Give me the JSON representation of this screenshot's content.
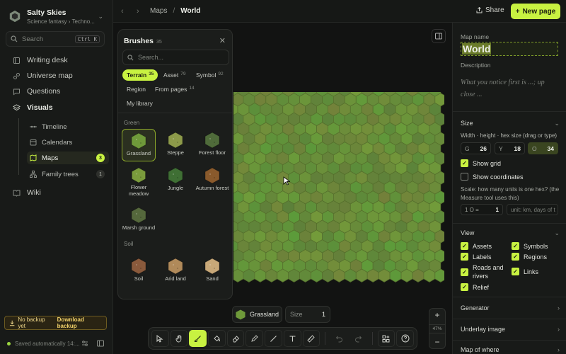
{
  "workspace": {
    "name": "Salty Skies",
    "subtitle": "Science fantasy › Techno..."
  },
  "search": {
    "placeholder": "Search",
    "shortcut": "Ctrl K"
  },
  "nav": {
    "writing_desk": "Writing desk",
    "universe_map": "Universe map",
    "questions": "Questions",
    "visuals": "Visuals",
    "timeline": "Timeline",
    "calendars": "Calendars",
    "maps": "Maps",
    "maps_count": "3",
    "family_trees": "Family trees",
    "family_trees_count": "1",
    "wiki": "Wiki"
  },
  "backup": {
    "status": "No backup yet",
    "action": "Download backup"
  },
  "saved": "Saved automatically 14:...",
  "breadcrumb": {
    "parent": "Maps",
    "separator": "/",
    "current": "World"
  },
  "topbar": {
    "share": "Share",
    "new_page": "New page"
  },
  "brushes": {
    "title": "Brushes",
    "count": "35",
    "search_placeholder": "Search...",
    "tabs": [
      {
        "label": "Terrain",
        "count": "35"
      },
      {
        "label": "Asset",
        "count": "79"
      },
      {
        "label": "Symbol",
        "count": "92"
      },
      {
        "label": "Region",
        "count": ""
      },
      {
        "label": "From pages",
        "count": "14"
      },
      {
        "label": "My library",
        "count": ""
      }
    ],
    "section_green": "Green",
    "green": [
      {
        "label": "Grassland",
        "color": "#6f9a3a"
      },
      {
        "label": "Steppe",
        "color": "#8d9a4a"
      },
      {
        "label": "Forest floor",
        "color": "#4f6b3a"
      },
      {
        "label": "Flower meadow",
        "color": "#7a9b3c"
      },
      {
        "label": "Jungle",
        "color": "#3f6f34"
      },
      {
        "label": "Autumn forest",
        "color": "#8a5a2c"
      },
      {
        "label": "Marsh ground",
        "color": "#55683c"
      }
    ],
    "section_soil": "Soil",
    "soil": [
      {
        "label": "Soil",
        "color": "#8a5a3c"
      },
      {
        "label": "Arid land",
        "color": "#b08a5a"
      },
      {
        "label": "Sand",
        "color": "#c8a878"
      }
    ]
  },
  "current_brush": {
    "name": "Grassland",
    "size_label": "Size",
    "size_value": "1"
  },
  "zoom": {
    "plus": "+",
    "level": "47%",
    "minus": "−"
  },
  "right_panel": {
    "map_name_label": "Map name",
    "map_name": "World",
    "description_label": "Description",
    "description_placeholder": "What you notice first is ...; up close ...",
    "size_label": "Size",
    "size_hint": "Width · height · hex size (drag or type)",
    "width_key": "G",
    "width": "26",
    "height_key": "Y",
    "height": "18",
    "hex_key": "O",
    "hex_size": "34",
    "show_grid": "Show grid",
    "show_coordinates": "Show coordinates",
    "scale_text": "Scale: how many units is one hex? (the Measure tool uses this)",
    "scale_key": "1 O =",
    "scale_value": "1",
    "unit_placeholder": "unit: km, days of t",
    "view_label": "View",
    "view": {
      "assets": "Assets",
      "symbols": "Symbols",
      "labels": "Labels",
      "regions": "Regions",
      "roads": "Roads and rivers",
      "links": "Links",
      "relief": "Relief"
    },
    "generator": "Generator",
    "underlay": "Underlay image",
    "map_of_where": "Map of where"
  },
  "colors": {
    "accent": "#c8f241",
    "grass": "#6f9a3a",
    "map_bg": "#121312"
  }
}
